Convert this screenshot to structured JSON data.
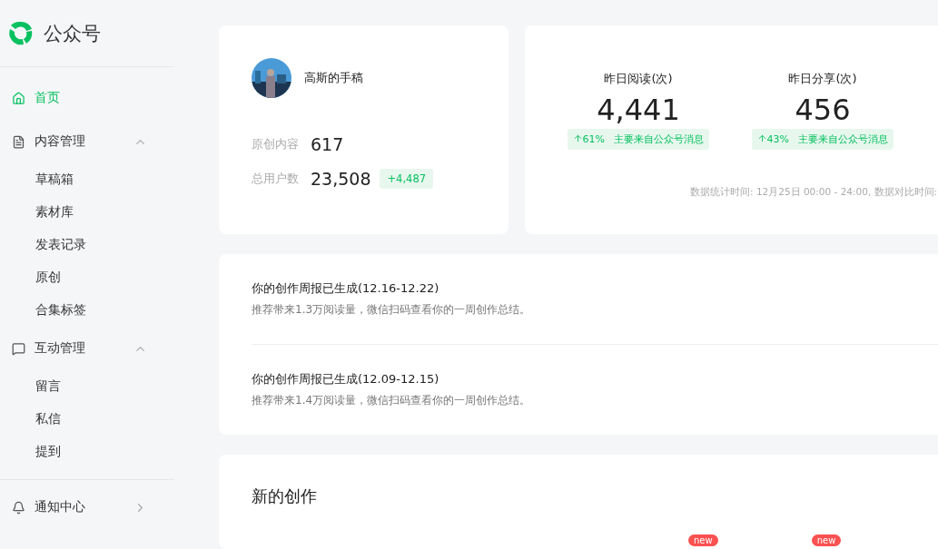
{
  "brand": {
    "name": "公众号"
  },
  "sidebar": {
    "items": [
      {
        "kind": "link",
        "label": "首页",
        "selected": true
      },
      {
        "kind": "group",
        "label": "内容管理",
        "expanded": true,
        "children": [
          {
            "label": "草稿箱",
            "selected": false
          },
          {
            "label": "素材库",
            "selected": false
          },
          {
            "label": "发表记录",
            "selected": false
          },
          {
            "label": "原创",
            "selected": false
          },
          {
            "label": "合集标签",
            "selected": false
          }
        ]
      },
      {
        "kind": "group",
        "label": "互动管理",
        "expanded": true,
        "children": [
          {
            "label": "留言",
            "selected": false
          },
          {
            "label": "私信",
            "selected": false
          },
          {
            "label": "提到",
            "selected": false
          }
        ]
      }
    ],
    "footer_items": [
      {
        "label": "通知中心"
      }
    ]
  },
  "account": {
    "name": "高斯的手稿",
    "stats": [
      {
        "label": "原创内容",
        "value": "617"
      },
      {
        "label": "总用户数",
        "value": "23,508",
        "delta": "+4,487"
      }
    ]
  },
  "metrics": [
    {
      "label": "昨日阅读(次)",
      "value": "4,441",
      "change": "61%",
      "source": "主要来自公众号消息"
    },
    {
      "label": "昨日分享(次)",
      "value": "456",
      "change": "43%",
      "source": "主要来自公众号消息"
    }
  ],
  "metrics_note": "数据统计时间: 12月25日 00:00 - 24:00, 数据对比时间:",
  "reports": [
    {
      "title": "你的创作周报已生成(12.16-12.22)",
      "text": "推荐带来1.3万阅读量，微信扫码查看你的一周创作总结。"
    },
    {
      "title": "你的创作周报已生成(12.09-12.15)",
      "text": "推荐带来1.4万阅读量，微信扫码查看你的一周创作总结。"
    }
  ],
  "new_creation": {
    "title": "新的创作",
    "badges": [
      "new",
      "new"
    ]
  }
}
